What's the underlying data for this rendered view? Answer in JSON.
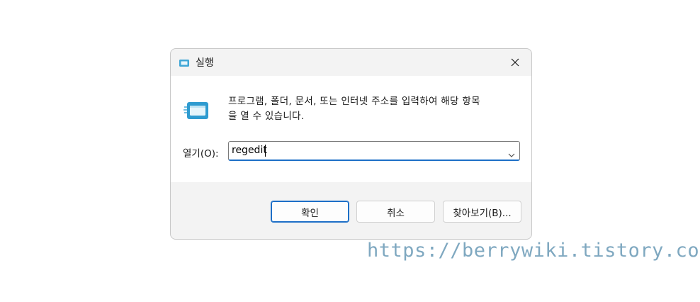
{
  "window": {
    "title": "실행",
    "title_icon": "run-icon",
    "close_icon": "close-icon"
  },
  "content": {
    "icon": "run-large-icon",
    "description_line1": "프로그램, 폴더, 문서, 또는 인터넷 주소를 입력하여 해당 항목",
    "description_line2": "을 열 수 있습니다.",
    "open_label": "열기(O):",
    "open_value": "regedit",
    "dropdown_icon": "chevron-down-icon"
  },
  "buttons": {
    "ok": "확인",
    "cancel": "취소",
    "browse": "찾아보기(B)..."
  },
  "watermark": "https://berrywiki.tistory.com",
  "colors": {
    "accent": "#1d6fc7",
    "watermark": "#7fa8c0"
  }
}
